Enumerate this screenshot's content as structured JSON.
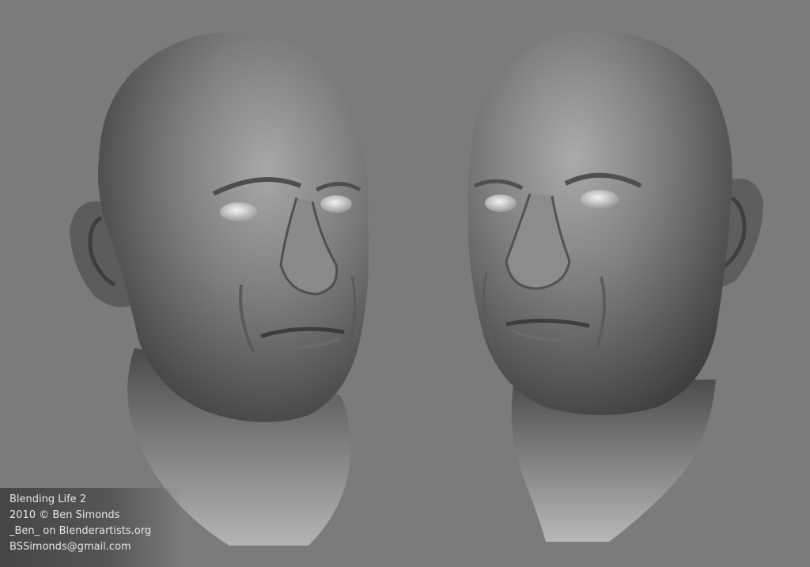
{
  "credits": {
    "title": "Blending Life 2",
    "copyright": "2010 © Ben Simonds",
    "forum": "_Ben_ on Blenderartists.org",
    "email": "BSSimonds@gmail.com"
  },
  "colors": {
    "background": "#7b7b7b",
    "sculpt": "#6e6e6e",
    "credit_text": "#e6e6e6"
  }
}
